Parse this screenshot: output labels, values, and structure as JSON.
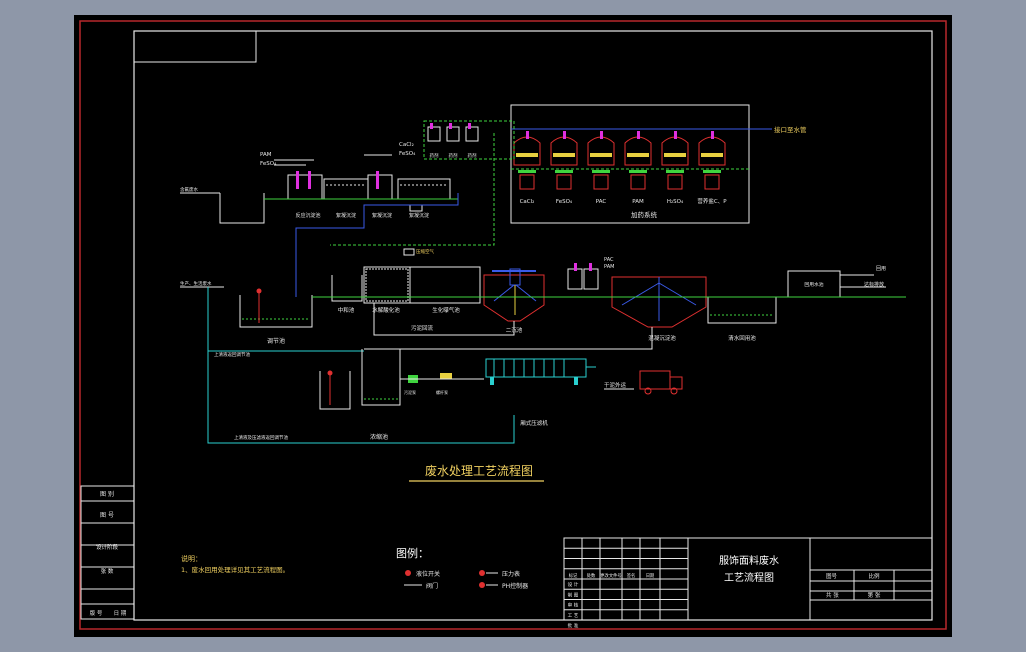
{
  "drawing": {
    "main_title": "废水处理工艺流程图",
    "chem_top": {
      "cacl": "CaCl₂",
      "feso": "FeSO₄",
      "pam": "PAM"
    },
    "chem_small": [
      "药剂",
      "药剂",
      "药剂"
    ],
    "discharge_pipe": "接口至水管",
    "dosing_tanks": [
      "CaCl₂",
      "FeSO₄",
      "PAC",
      "PAM",
      "H₂SO₄",
      "营养盐C、P"
    ],
    "dosing_room": "加药系统",
    "top_inlet": "含氟废水",
    "top_units": [
      "反应沉淀池",
      "絮凝沉淀",
      "絮凝沉淀",
      "絮凝沉淀"
    ],
    "inlet_line": "生产、生活废水",
    "units": {
      "regulating": "调节池",
      "neutral": "中和池",
      "hydrolysis": "水解酸化池",
      "aeration": "生化曝气池",
      "secondary": "二沉池",
      "coag": "混凝沉淀池",
      "clear": "清水回用池",
      "sludge_return": "污泥回流",
      "thickener": "浓缩池",
      "press": "厢式压滤机",
      "sludge_cake": "干泥外运",
      "reuse_tank": "回用水池",
      "reuse_label": "回用",
      "discharge": "达标排放"
    },
    "labels": {
      "pac": "PAC",
      "pam": "PAM",
      "aeration_pipe": "压缩空气",
      "supernatant": "上清液返回调节池",
      "sludge_pump": "污泥泵",
      "screw_pump": "螺杆泵",
      "to_press": "污泥泵",
      "filtrate": "上清液及压滤液返回调节池"
    }
  },
  "left_strip": [
    "图 别",
    "图 号",
    "设计阶段",
    "张 数",
    "版 号",
    "日 期"
  ],
  "notes": {
    "title": "说明：",
    "line1": "1、废水回用处理详见其工艺流程图。"
  },
  "legend": {
    "title": "图例：",
    "items": [
      "液位开关",
      "压力表",
      "阀门",
      "PH控制器"
    ]
  },
  "title_block": {
    "project_name_1": "服饰面料废水",
    "project_name_2": "工艺流程图",
    "rows_left": [
      [
        "设 计",
        "",
        "",
        "",
        ""
      ],
      [
        "制 图",
        "",
        "",
        "",
        ""
      ],
      [
        "审 核",
        "",
        "",
        "",
        ""
      ],
      [
        "工 艺",
        "",
        "",
        "",
        ""
      ],
      [
        "批 准",
        "",
        "",
        "",
        ""
      ]
    ],
    "mid_row": [
      "标记",
      "处数",
      "更改文件号",
      "签名",
      "日期"
    ],
    "right_cells": [
      "图号",
      "比例",
      "共 张",
      "第 张"
    ]
  },
  "colors": {
    "frame_red": "#b8282c",
    "line_white": "#e8e8e8",
    "pipe_green": "#3fd43f",
    "pipe_cyan": "#2ad0d0",
    "pipe_blue": "#3a5ae8",
    "tank_red": "#e03030",
    "mark_yellow": "#e8d040",
    "mark_magenta": "#e030e0"
  }
}
